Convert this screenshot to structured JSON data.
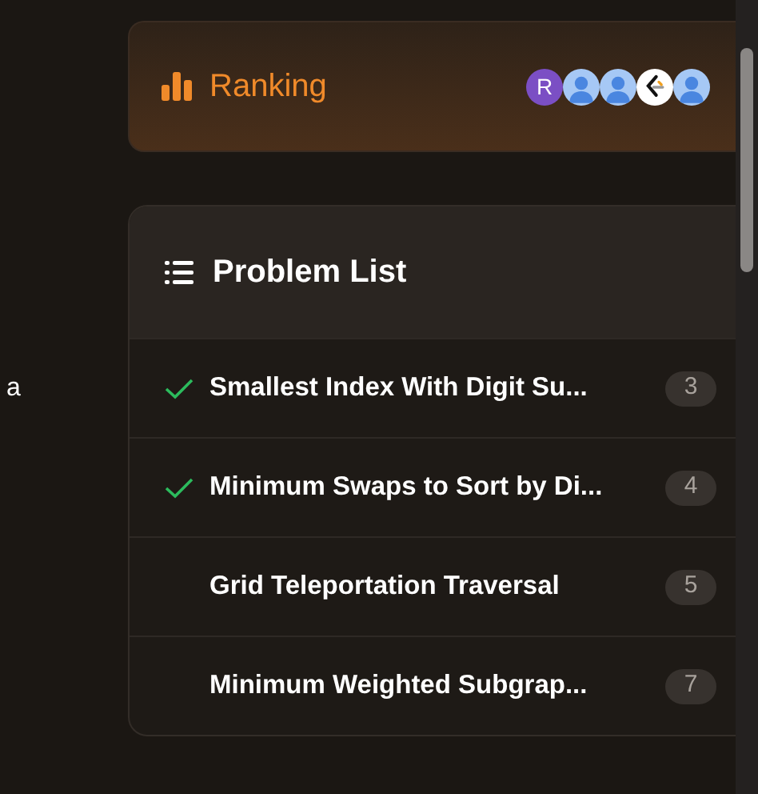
{
  "side_text": "a",
  "ranking": {
    "title": "Ranking",
    "avatars": [
      {
        "kind": "letter",
        "text": "R"
      },
      {
        "kind": "person"
      },
      {
        "kind": "person"
      },
      {
        "kind": "logo"
      },
      {
        "kind": "person"
      }
    ]
  },
  "problem_list": {
    "title": "Problem List",
    "items": [
      {
        "title": "Smallest Index With Digit Su...",
        "solved": true,
        "count": "3"
      },
      {
        "title": "Minimum Swaps to Sort by Di...",
        "solved": true,
        "count": "4"
      },
      {
        "title": "Grid Teleportation Traversal",
        "solved": false,
        "count": "5"
      },
      {
        "title": "Minimum Weighted Subgrap...",
        "solved": false,
        "count": "7"
      }
    ]
  }
}
